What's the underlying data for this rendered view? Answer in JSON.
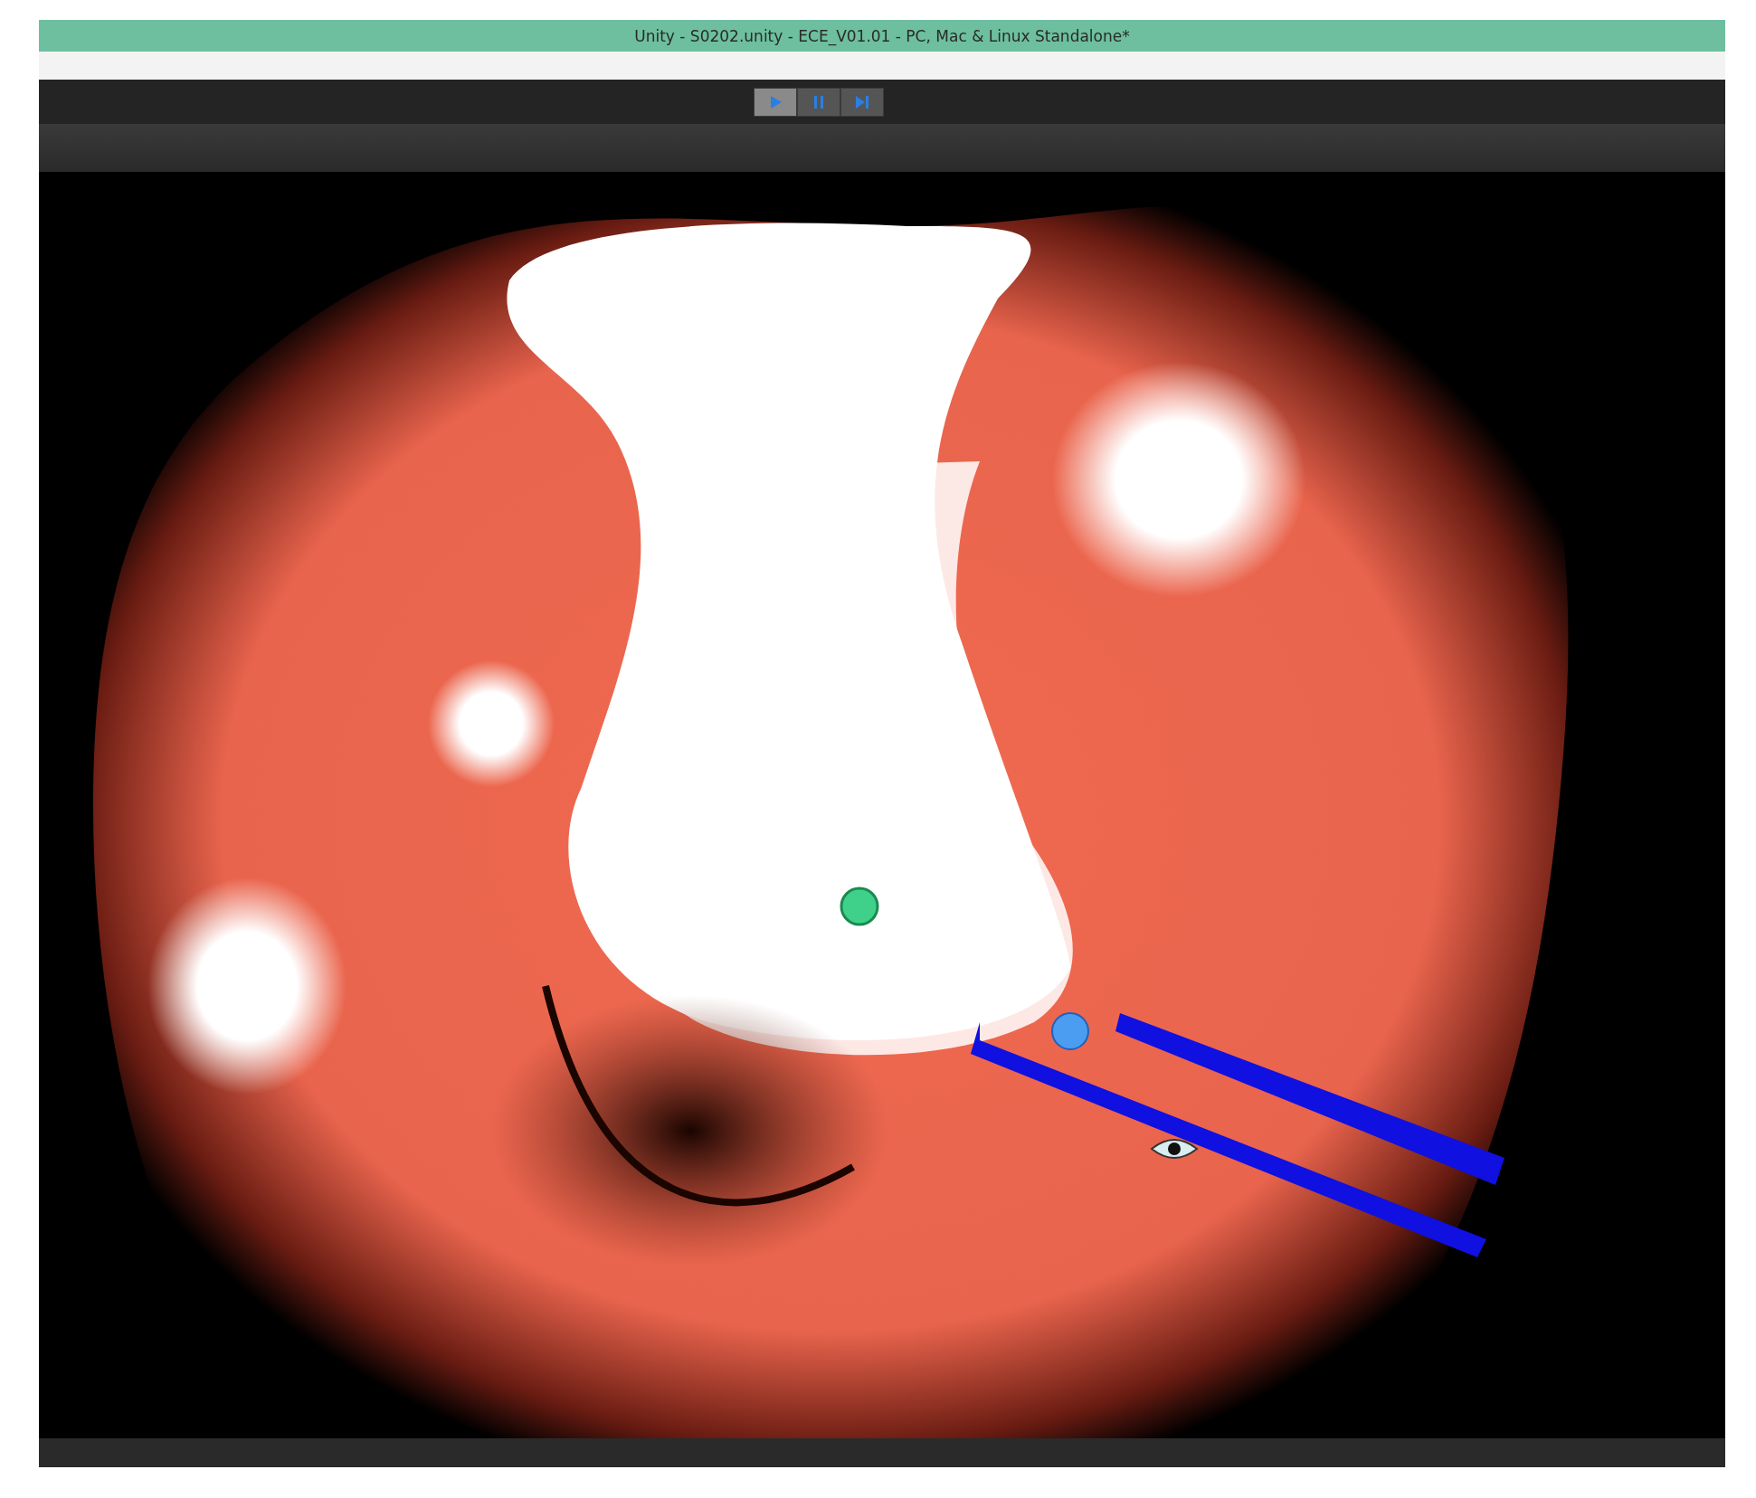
{
  "window": {
    "title": "Unity - S0202.unity - ECE_V01.01 - PC, Mac & Linux Standalone*"
  },
  "toolbar": {
    "buttons": [
      {
        "kind": "play",
        "selected": true
      },
      {
        "kind": "pause",
        "selected": false
      },
      {
        "kind": "step",
        "selected": false
      }
    ]
  }
}
